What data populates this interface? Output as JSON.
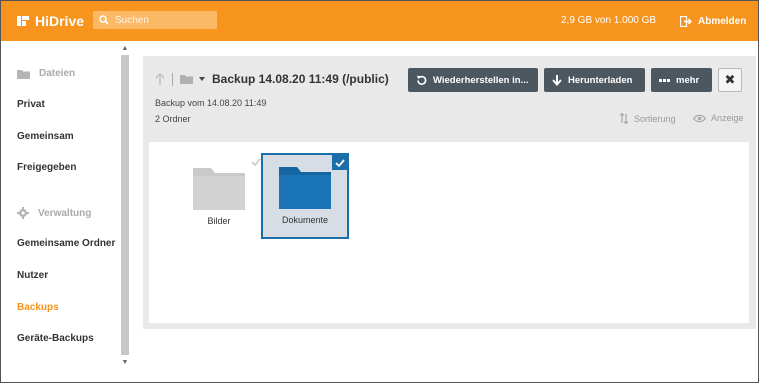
{
  "header": {
    "logo_text": "HiDrive",
    "search_placeholder": "Suchen",
    "storage": "2,9 GB von 1.000 GB",
    "logout_label": "Abmelden"
  },
  "sidebar": {
    "section_files": "Dateien",
    "files_items": [
      "Privat",
      "Gemeinsam",
      "Freigegeben"
    ],
    "section_admin": "Verwaltung",
    "admin_items": [
      "Gemeinsame Ordner",
      "Nutzer",
      "Backups",
      "Geräte-Backups"
    ],
    "active_item": "Backups"
  },
  "main": {
    "title": "Backup 14.08.20 11:49 (/public)",
    "subtitle": "Backup vom 14.08.20 11:49",
    "count": "2 Ordner",
    "buttons": {
      "restore": "Wiederherstellen in...",
      "download": "Herunterladen",
      "more": "mehr"
    },
    "sort_label": "Sortierung",
    "view_label": "Anzeige",
    "folders": [
      {
        "name": "Bilder",
        "selected": false
      },
      {
        "name": "Dokumente",
        "selected": true
      }
    ]
  },
  "colors": {
    "brand_orange": "#f7941d",
    "accent_blue": "#1b6ea8",
    "button_dark": "#4d5760",
    "folder_grey": "#c9c9c9"
  }
}
